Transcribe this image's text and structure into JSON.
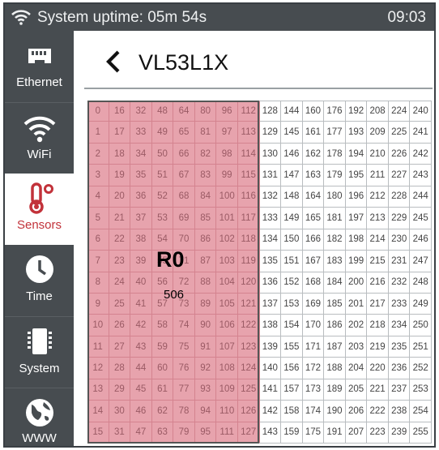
{
  "status_bar": {
    "uptime": "System uptime: 05m 54s",
    "time": "09:03",
    "wifi_icon": "wifi-icon"
  },
  "sidebar": {
    "items": [
      {
        "label": "Ethernet",
        "icon": "ethernet-icon",
        "active": false
      },
      {
        "label": "WiFi",
        "icon": "wifi-icon",
        "active": false
      },
      {
        "label": "Sensors",
        "icon": "thermometer-icon",
        "active": true
      },
      {
        "label": "Time",
        "icon": "clock-icon",
        "active": false
      },
      {
        "label": "System",
        "icon": "chip-icon",
        "active": false
      },
      {
        "label": "WWW",
        "icon": "globe-icon",
        "active": false
      }
    ]
  },
  "header": {
    "title": "VL53L1X",
    "back_icon": "chevron-left-icon"
  },
  "roi": {
    "label": "R0",
    "center": "506",
    "selected_columns": 8
  },
  "grid": {
    "columns": 16,
    "rows": 16,
    "numbering": "column-major",
    "selection_color": "#e7a3ad"
  },
  "colors": {
    "sidebar_bg": "#474c50",
    "active_accent": "#c2323a"
  }
}
